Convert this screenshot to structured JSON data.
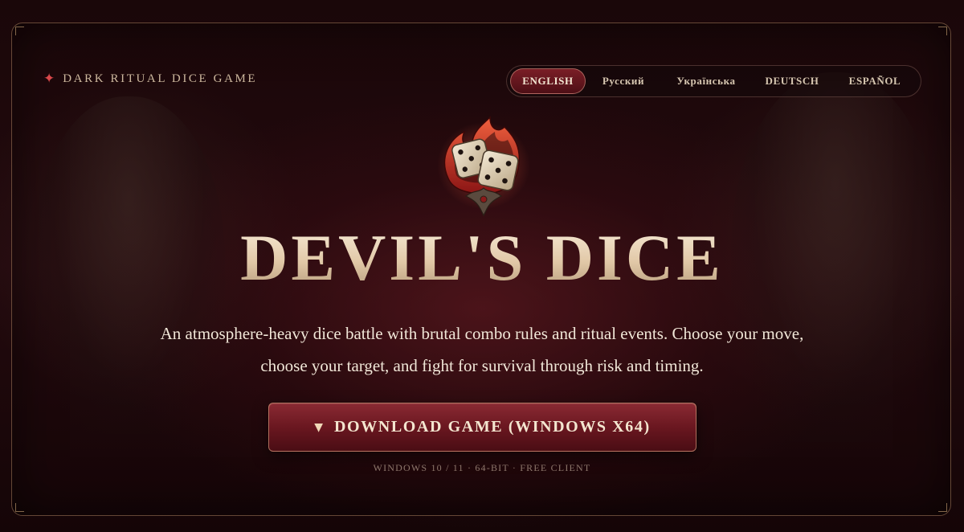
{
  "brand": {
    "icon": "star-icon",
    "label": "DARK RITUAL DICE GAME"
  },
  "languages": {
    "items": [
      {
        "label": "ENGLISH",
        "active": true
      },
      {
        "label": "Русский",
        "active": false
      },
      {
        "label": "Українська",
        "active": false
      },
      {
        "label": "DEUTSCH",
        "active": false
      },
      {
        "label": "ESPAÑOL",
        "active": false
      }
    ]
  },
  "hero": {
    "emblem_icon": "flaming-dice-emblem-icon",
    "title": "DEVIL'S DICE",
    "tagline_line1": "An atmosphere-heavy dice battle with brutal combo rules and ritual events. Choose your move,",
    "tagline_line2": "choose your target, and fight for survival through risk and timing."
  },
  "download": {
    "arrow_icon": "triangle-down-icon",
    "label": "DOWNLOAD GAME (WINDOWS X64)",
    "note": "WINDOWS 10 / 11 · 64-BIT · FREE CLIENT"
  },
  "colors": {
    "accent_red": "#7a1e26",
    "brand_star": "#d8484a",
    "title_gold": "#e7d2b6",
    "background": "#1a0709"
  }
}
